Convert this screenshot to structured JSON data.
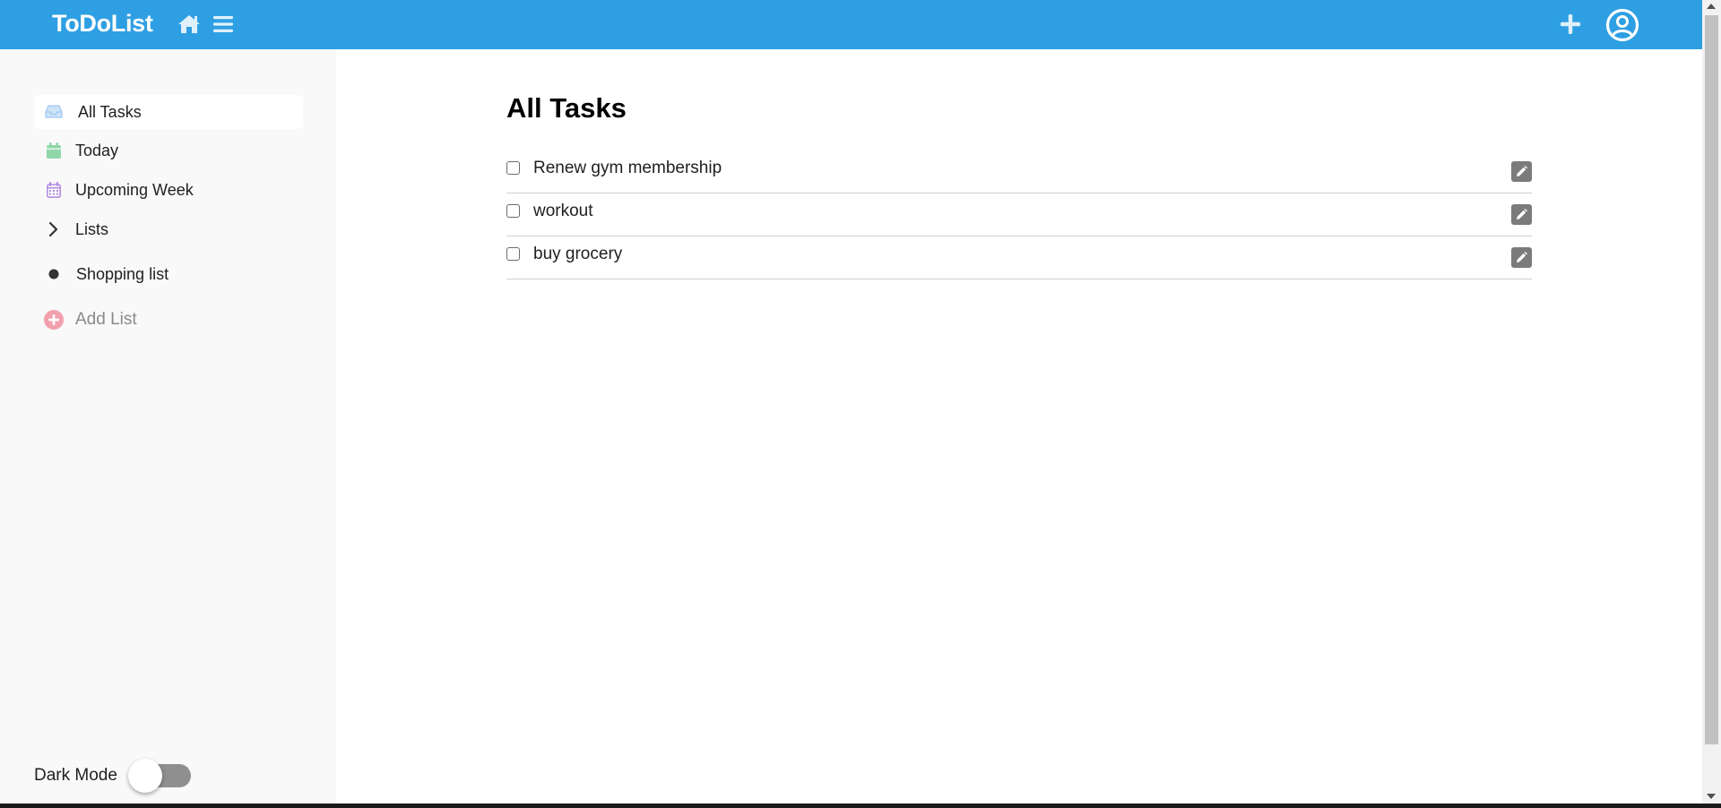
{
  "app": {
    "title": "ToDoList"
  },
  "header": {
    "brand": "ToDoList",
    "icons": [
      "home-icon",
      "hamburger-menu-icon",
      "plus-icon",
      "user-circle-icon"
    ],
    "background_color": "#2f9fe3"
  },
  "sidebar": {
    "items": [
      {
        "label": "All Tasks",
        "icon": "inbox-icon",
        "icon_color": "#9ec8f2",
        "active": true
      },
      {
        "label": "Today",
        "icon": "calendar-icon",
        "icon_color": "#7fcf9b"
      },
      {
        "label": "Upcoming Week",
        "icon": "calendar-week-icon",
        "icon_color": "#b48ee6"
      },
      {
        "label": "Lists",
        "icon": "chevron-right-icon",
        "icon_color": "#333333"
      },
      {
        "label": "Shopping list",
        "icon": "dot-icon",
        "icon_color": "#333333"
      },
      {
        "label": "Add List",
        "icon": "plus-circle-icon",
        "icon_color": "#f2a0ad"
      }
    ],
    "dark_mode": {
      "label": "Dark Mode",
      "enabled": false
    }
  },
  "main": {
    "title": "All Tasks",
    "tasks": [
      {
        "text": "Renew gym membership",
        "checked": false
      },
      {
        "text": "workout",
        "checked": false
      },
      {
        "text": "buy grocery",
        "checked": false
      }
    ]
  }
}
